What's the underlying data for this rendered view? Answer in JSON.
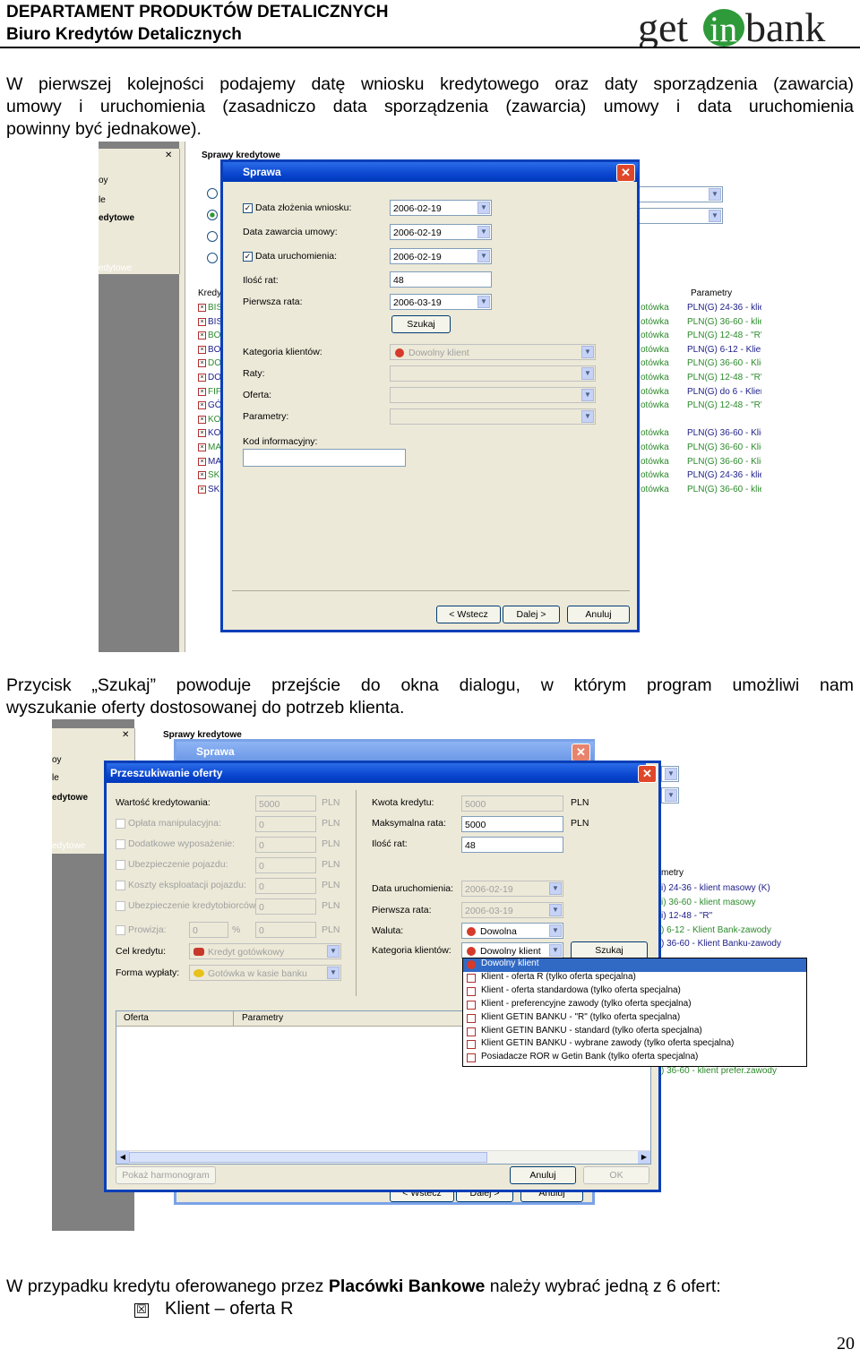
{
  "header": {
    "line1": "DEPARTAMENT PRODUKTÓW DETALICZNYCH",
    "line2": "Biuro Kredytów Detalicznych",
    "logo": {
      "text_before": "get",
      "text_in": "in",
      "text_after": "bank"
    }
  },
  "paragraph1": {
    "lines": [
      "W pierwszej kolejności podajemy datę wniosku kredytowego oraz daty sporządzenia (zawarcia)",
      "umowy i uruchomienia (zasadniczo data sporządzenia (zawarcia) umowy i data uruchomienia",
      "powinny być jednakowe)."
    ]
  },
  "shot1": {
    "background_window_title": "Sprawy kredytowe",
    "left_items": [
      "oy",
      "le",
      "edytowe",
      "edytowe"
    ],
    "list_header": "Kredy",
    "list_codes": [
      "BIS",
      "BIS",
      "BO",
      "BO",
      "DO",
      "DO",
      "FIF",
      "GÓ",
      "KO",
      "KO",
      "MA",
      "MA",
      "SK",
      "SK"
    ],
    "right_col1": [
      "otówka",
      "otówka",
      "otówka",
      "otówka",
      "otówka",
      "otówka",
      "otówka",
      "otówka",
      "",
      "otówka",
      "otówka",
      "otówka",
      "otówka",
      "otówka"
    ],
    "right_header": "Parametry",
    "right_col2": [
      "PLN(G) 24-36 - klie",
      "PLN(G) 36-60 - klie",
      "PLN(G) 12-48 - \"R\"",
      "PLN(G) 6-12 - Klien",
      "PLN(G) 36-60 - Klie",
      "PLN(G) 12-48 - \"R\"",
      "PLN(G) do 6 - Klien",
      "PLN(G) 12-48 - \"R\"",
      "",
      "PLN(G) 36-60 - Klie",
      "PLN(G) 36-60 - Klie",
      "PLN(G) 36-60 - Klie",
      "PLN(G) 24-36 - klie",
      "PLN(G) 36-60 - klie"
    ],
    "dialog": {
      "title": "Sprawa",
      "close": "✕",
      "fields": [
        {
          "label": "Data złożenia wniosku:",
          "value": "2006-02-19",
          "checked": true
        },
        {
          "label": "Data zawarcia umowy:",
          "value": "2006-02-19",
          "checked": false
        },
        {
          "label": "Data uruchomienia:",
          "value": "2006-02-19",
          "checked": true
        },
        {
          "label": "Ilość rat:",
          "value": "48"
        },
        {
          "label": "Pierwsza rata:",
          "value": "2006-03-19"
        }
      ],
      "search_button": "Szukaj",
      "kategoria_label": "Kategoria klientów:",
      "kategoria_value": "Dowolny klient",
      "raty_label": "Raty:",
      "oferta_label": "Oferta:",
      "parametry_label": "Parametry:",
      "kod_label": "Kod informacyjny:",
      "back_button": "< Wstecz",
      "next_button": "Dalej >",
      "cancel_button": "Anuluj"
    }
  },
  "paragraph2": {
    "lines": [
      "Przycisk „Szukaj” powoduje przejście do okna dialogu, w którym program umożliwi nam",
      "wyszukanie oferty dostosowanej do potrzeb klienta."
    ]
  },
  "shot2": {
    "background_window_title": "Sprawy kredytowe",
    "sprawa_title": "Sprawa",
    "left_items": [
      "oy",
      "le",
      "edytowe",
      "edytowe"
    ],
    "dialog": {
      "title": "Przeszukiwanie oferty",
      "close": "✕",
      "left_rows": [
        {
          "label": "Wartość kredytowania:",
          "value": "5000",
          "unit": "PLN",
          "checkbox": false
        },
        {
          "label": "Opłata manipulacyjna:",
          "value": "0",
          "unit": "PLN",
          "checkbox": true
        },
        {
          "label": "Dodatkowe wyposażenie:",
          "value": "0",
          "unit": "PLN",
          "checkbox": true
        },
        {
          "label": "Ubezpieczenie pojazdu:",
          "value": "0",
          "unit": "PLN",
          "checkbox": true
        },
        {
          "label": "Koszty eksploatacji pojazdu:",
          "value": "0",
          "unit": "PLN",
          "checkbox": true
        },
        {
          "label": "Ubezpieczenie kredytobiorców:",
          "value": "0",
          "unit": "PLN",
          "checkbox": true
        }
      ],
      "prowizja": {
        "label": "Prowizja:",
        "value": "0",
        "percent": "%",
        "value2": "0",
        "unit": "PLN"
      },
      "cel_label": "Cel kredytu:",
      "cel_value": "Kredyt gotówkowy",
      "forma_label": "Forma wypłaty:",
      "forma_value": "Gotówka w kasie banku",
      "right_rows": [
        {
          "label": "Kwota kredytu:",
          "value": "5000",
          "unit": "PLN"
        },
        {
          "label": "Maksymalna rata:",
          "value": "5000",
          "unit": "PLN"
        },
        {
          "label": "Ilość rat:",
          "value": "48"
        }
      ],
      "data_label": "Data uruchomienia:",
      "data_value": "2006-02-19",
      "pierwsza_label": "Pierwsza rata:",
      "pierwsza_value": "2006-03-19",
      "waluta_label": "Waluta:",
      "waluta_value": "Dowolna",
      "kategoria_label": "Kategoria klientów:",
      "kategoria_value": "Dowolny klient",
      "search_button": "Szukaj",
      "table_headers": [
        "Oferta",
        "Parametry"
      ],
      "harmonogram_button": "Pokaż harmonogram",
      "cancel_button": "Anuluj",
      "ok_button": "OK"
    },
    "dropdown_options": [
      "Dowolny klient",
      "Klient - oferta R (tylko oferta specjalna)",
      "Klient - oferta standardowa (tylko oferta specjalna)",
      "Klient - preferencyjne zawody (tylko oferta specjalna)",
      "Klient GETIN BANKU - \"R\" (tylko oferta specjalna)",
      "Klient GETIN BANKU - standard (tylko oferta specjalna)",
      "Klient GETIN BANKU - wybrane zawody (tylko oferta specjalna)",
      "Posiadacze ROR w Getin Bank (tylko oferta specjalna)"
    ],
    "background_right_header": "metry",
    "background_right_rows": [
      "i) 24-36 - klient masowy (K)",
      "i) 36-60 - klient masowy",
      "i) 12-48 - \"R\"",
      ") 6-12 - Klient Bank-zawody",
      ") 36-60 - Klient Banku-zawody",
      ") 36-60 - klient prefer.zawody"
    ],
    "background_buttons": [
      "< Wstecz",
      "Dalej >",
      "Anuluj"
    ]
  },
  "paragraph3": {
    "text_before": "W przypadku kredytu oferowanego przez ",
    "text_bold": "Placówki Bankowe",
    "text_after": " należy wybrać jedną z 6 ofert:"
  },
  "bullet": {
    "symbol": "☒",
    "text": "Klient – oferta R"
  },
  "page_number": "20"
}
